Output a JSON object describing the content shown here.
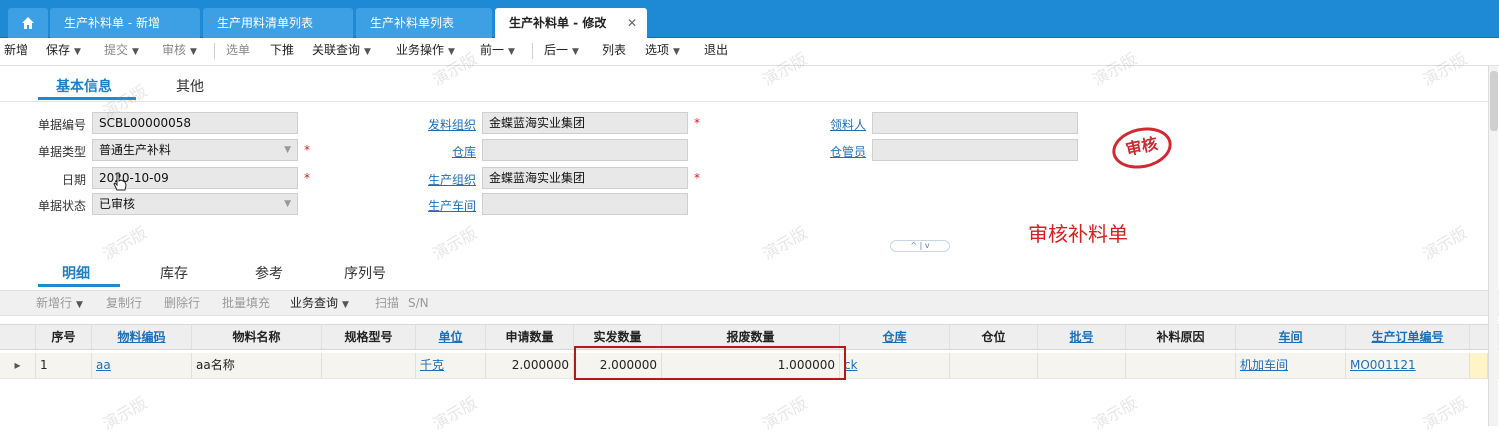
{
  "tabs": [
    {
      "label": "生产补料单 - 新增"
    },
    {
      "label": "生产用料清单列表"
    },
    {
      "label": "生产补料单列表"
    },
    {
      "label": "生产补料单 - 修改"
    }
  ],
  "tab_close": "✕",
  "toolbar": {
    "new": "新增",
    "save": "保存",
    "submit": "提交",
    "audit": "审核",
    "select_order": "选单",
    "push_down": "下推",
    "related_query": "关联查询",
    "business_ops": "业务操作",
    "prev": "前一",
    "next": "后一",
    "list": "列表",
    "options": "选项",
    "exit": "退出"
  },
  "section_tabs": {
    "basic": "基本信息",
    "other": "其他"
  },
  "form": {
    "doc_no_label": "单据编号",
    "doc_no": "SCBL00000058",
    "doc_type_label": "单据类型",
    "doc_type": "普通生产补料",
    "date_label": "日期",
    "date": "2020-10-09",
    "status_label": "单据状态",
    "status": "已审核",
    "issue_org_label": "发料组织",
    "issue_org": "金蝶蓝海实业集团",
    "warehouse_label": "仓库",
    "warehouse": "",
    "prod_org_label": "生产组织",
    "prod_org": "金蝶蓝海实业集团",
    "workshop_label": "生产车间",
    "workshop": "",
    "picker_label": "领料人",
    "picker": "",
    "keeper_label": "仓管员",
    "keeper": "",
    "required_mark": "*"
  },
  "stamp": "审核",
  "note": "审核补料单",
  "collapse_toggle": "^ | v",
  "detail_tabs": {
    "detail": "明细",
    "stock": "库存",
    "reference": "参考",
    "serial": "序列号"
  },
  "grid_toolbar": {
    "add_row": "新增行",
    "copy_row": "复制行",
    "delete_row": "删除行",
    "batch_fill": "批量填充",
    "business_query": "业务查询",
    "scan": "扫描",
    "sn": "S/N"
  },
  "grid": {
    "headers": {
      "seq": "序号",
      "material_code": "物料编码",
      "material_name": "物料名称",
      "spec": "规格型号",
      "unit": "单位",
      "apply_qty": "申请数量",
      "actual_qty": "实发数量",
      "scrap_qty": "报废数量",
      "warehouse": "仓库",
      "location": "仓位",
      "lot": "批号",
      "reason": "补料原因",
      "workshop": "车间",
      "mo_no": "生产订单编号"
    },
    "row": {
      "seq": "1",
      "material_code": "aa",
      "material_name": "aa名称",
      "spec": "",
      "unit": "千克",
      "apply_qty": "2.000000",
      "actual_qty": "2.000000",
      "scrap_qty": "1.000000",
      "warehouse": "ck",
      "location": "",
      "lot": "",
      "reason": "",
      "workshop": "机加车间",
      "mo_no": "MO001121"
    }
  },
  "watermark": "演示版"
}
